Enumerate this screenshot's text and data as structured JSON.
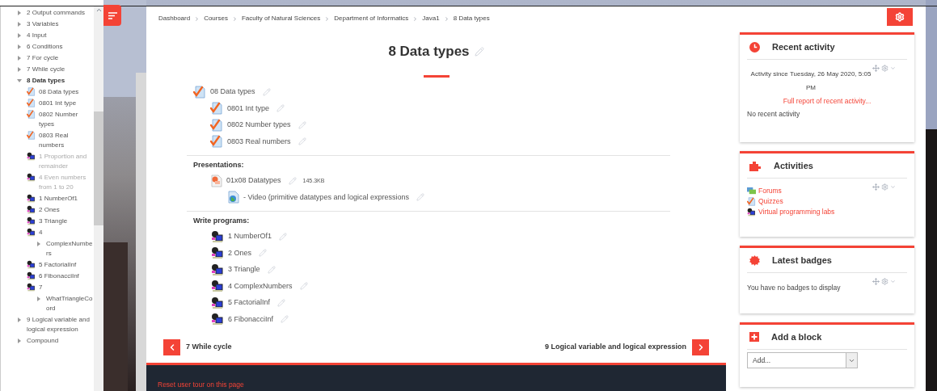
{
  "sidebar": {
    "items": [
      {
        "kind": "section",
        "label": "2 Output commands",
        "expanded": false
      },
      {
        "kind": "section",
        "label": "3 Variables",
        "expanded": false
      },
      {
        "kind": "section",
        "label": "4 Input",
        "expanded": false
      },
      {
        "kind": "section",
        "label": "6 Conditions",
        "expanded": false
      },
      {
        "kind": "section",
        "label": "7 For cycle",
        "expanded": false
      },
      {
        "kind": "section",
        "label": "7 While cycle",
        "expanded": false
      },
      {
        "kind": "section",
        "label": "8 Data types",
        "expanded": true,
        "children": [
          {
            "kind": "quiz",
            "label": "08 Data types",
            "dimmed": false
          },
          {
            "kind": "quiz",
            "label": "0801 Int type",
            "dimmed": false
          },
          {
            "kind": "quiz",
            "label": "0802 Number types",
            "dimmed": false
          },
          {
            "kind": "quiz",
            "label": "0803 Real numbers",
            "dimmed": false
          },
          {
            "kind": "vpl",
            "label": "1 Proportion and remainder",
            "dimmed": true
          },
          {
            "kind": "vpl",
            "label": "4 Even numbers from 1 to 20",
            "dimmed": true
          },
          {
            "kind": "vpl",
            "label": "1 NumberOf1",
            "dimmed": false
          },
          {
            "kind": "vpl",
            "label": "2 Ones",
            "dimmed": false
          },
          {
            "kind": "vpl",
            "label": "3 Triangle",
            "dimmed": false
          },
          {
            "kind": "vpl",
            "label": "4",
            "dimmed": false,
            "children": [
              {
                "kind": "section",
                "label": "ComplexNumbers",
                "expanded": false
              }
            ]
          },
          {
            "kind": "vpl",
            "label": "5 FactorialInf",
            "dimmed": false
          },
          {
            "kind": "vpl",
            "label": "6 FibonacciInf",
            "dimmed": false
          },
          {
            "kind": "vpl",
            "label": "7",
            "dimmed": false,
            "children": [
              {
                "kind": "section",
                "label": "WhatTriangleCoord",
                "expanded": false
              }
            ]
          }
        ]
      },
      {
        "kind": "section",
        "label": "9 Logical variable and logical expression",
        "expanded": false
      },
      {
        "kind": "section",
        "label": "Compound",
        "expanded": false
      }
    ]
  },
  "breadcrumb": [
    "Dashboard",
    "Courses",
    "Faculty of Natural Sciences",
    "Department of Informatics",
    "Java1",
    "8 Data types"
  ],
  "title": "8 Data types",
  "activities": [
    {
      "kind": "quiz",
      "label": "08 Data types",
      "children": [
        {
          "kind": "quiz",
          "label": "0801 Int type"
        },
        {
          "kind": "quiz",
          "label": "0802 Number types"
        },
        {
          "kind": "quiz",
          "label": "0803 Real numbers"
        }
      ]
    }
  ],
  "groups": [
    {
      "heading": "Presentations:",
      "items": [
        {
          "kind": "ppt",
          "label": "01x08 Datatypes",
          "size": "145.3KB",
          "children": [
            {
              "kind": "url",
              "label": "- Video (primitive datatypes and logical expressions"
            }
          ]
        }
      ]
    },
    {
      "heading": "Write programs:",
      "items": [
        {
          "kind": "vpl",
          "label": "1 NumberOf1"
        },
        {
          "kind": "vpl",
          "label": "2 Ones"
        },
        {
          "kind": "vpl",
          "label": "3 Triangle"
        },
        {
          "kind": "vpl",
          "label": "4 ComplexNumbers"
        },
        {
          "kind": "vpl",
          "label": "5 FactorialInf"
        },
        {
          "kind": "vpl",
          "label": "6 FibonacciInf"
        }
      ]
    }
  ],
  "navigation": {
    "previous": "7 While cycle",
    "next": "9 Logical variable and logical expression"
  },
  "footer": {
    "link": "Reset user tour on this page"
  },
  "blocks": [
    {
      "kind": "recent",
      "title": "Recent activity",
      "since": "Activity since Tuesday, 26 May 2020, 5:05 PM",
      "link": "Full report of recent activity...",
      "note": "No recent activity"
    },
    {
      "kind": "activities",
      "title": "Activities",
      "links": [
        {
          "kind": "forum",
          "label": "Forums"
        },
        {
          "kind": "quiz",
          "label": "Quizzes"
        },
        {
          "kind": "vpl",
          "label": "Virtual programming labs"
        }
      ]
    },
    {
      "kind": "badges",
      "title": "Latest badges",
      "note": "You have no badges to display"
    },
    {
      "kind": "add",
      "title": "Add a block",
      "select": "Add..."
    }
  ]
}
